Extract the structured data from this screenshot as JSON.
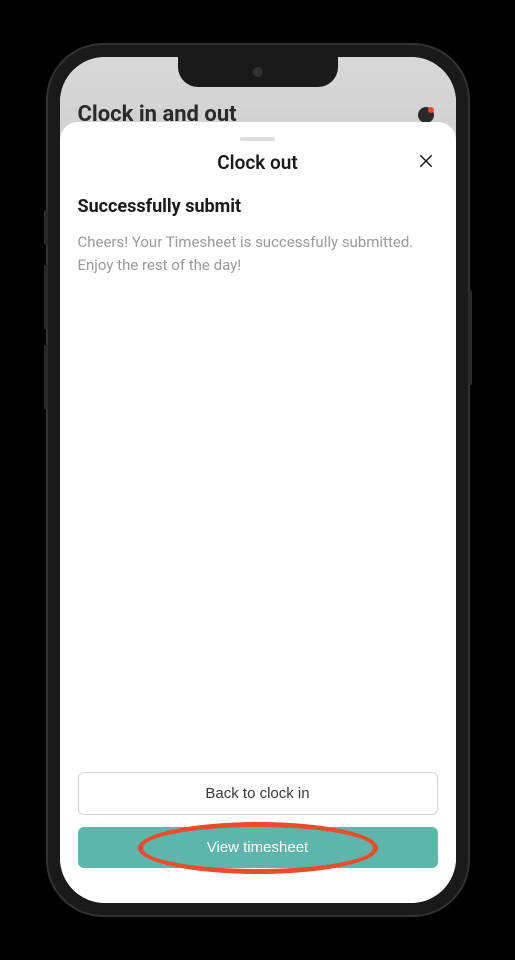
{
  "background": {
    "title": "Clock in and out"
  },
  "modal": {
    "title": "Clock out",
    "heading": "Successfully submit",
    "message": "Cheers! Your Timesheet is successfully submitted. Enjoy the rest of the day!",
    "backButton": "Back to clock in",
    "viewButton": "View timesheet"
  }
}
